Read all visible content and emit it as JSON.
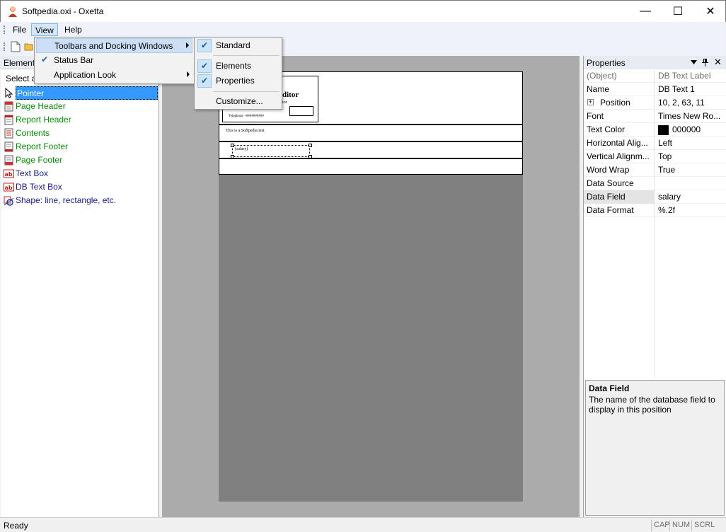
{
  "window": {
    "title": "Softpedia.oxi - Oxetta",
    "minimize": "—",
    "maximize": "☐",
    "close": "✕"
  },
  "menubar": {
    "items": [
      {
        "label": "File"
      },
      {
        "label": "View"
      },
      {
        "label": "Help"
      }
    ]
  },
  "view_menu": {
    "items": [
      {
        "label": "Toolbars and Docking Windows",
        "checked": false,
        "submenu": true
      },
      {
        "label": "Status Bar",
        "checked": true,
        "submenu": false
      },
      {
        "label": "Application Look",
        "checked": false,
        "submenu": true
      }
    ]
  },
  "toolbars_submenu": {
    "items": [
      {
        "label": "Standard",
        "checked": true
      },
      {
        "label": "Elements",
        "checked": true
      },
      {
        "label": "Properties",
        "checked": true
      },
      {
        "label": "Customize...",
        "checked": false
      }
    ]
  },
  "elements_panel": {
    "title": "Element",
    "subtitle": "Select a",
    "items": [
      {
        "label": "Pointer",
        "icon": "pointer-icon"
      },
      {
        "label": "Page Header",
        "icon": "page-header-icon"
      },
      {
        "label": "Report Header",
        "icon": "report-header-icon"
      },
      {
        "label": "Contents",
        "icon": "contents-icon"
      },
      {
        "label": "Report Footer",
        "icon": "report-footer-icon"
      },
      {
        "label": "Page Footer",
        "icon": "page-footer-icon"
      },
      {
        "label": "Text Box",
        "icon": "text-box-icon"
      },
      {
        "label": "DB Text Box",
        "icon": "db-text-box-icon"
      },
      {
        "label": "Shape: line, rectangle, etc.",
        "icon": "shape-icon"
      }
    ]
  },
  "report": {
    "header_title": "ditor",
    "header_sub": "tor",
    "telephone": "Telephone +##########",
    "contents_text": "This is a Softpedia test",
    "db_field_text": "[salary]"
  },
  "properties_panel": {
    "title": "Properties",
    "rows": [
      {
        "name": "(Object)",
        "value": "DB Text Label"
      },
      {
        "name": "Name",
        "value": "DB Text 1"
      },
      {
        "name": "Position",
        "value": "10, 2, 63, 11"
      },
      {
        "name": "Font",
        "value": "Times New Ro..."
      },
      {
        "name": "Text Color",
        "value": "000000"
      },
      {
        "name": "Horizontal Alig...",
        "value": "Left"
      },
      {
        "name": "Vertical Alignm...",
        "value": "Top"
      },
      {
        "name": "Word Wrap",
        "value": "True"
      },
      {
        "name": "Data Source",
        "value": ""
      },
      {
        "name": "Data Field",
        "value": "salary"
      },
      {
        "name": "Data Format",
        "value": "%.2f"
      }
    ],
    "description_title": "Data Field",
    "description_text": "The name of the database field to display in this position"
  },
  "statusbar": {
    "text": "Ready",
    "indicators": [
      "CAP",
      "NUM",
      "SCRL"
    ]
  },
  "colors": {
    "selection": "#3399ff",
    "element_green": "#0a8a0a",
    "element_navy": "#1a1a8a",
    "text_color_swatch": "#000000"
  }
}
